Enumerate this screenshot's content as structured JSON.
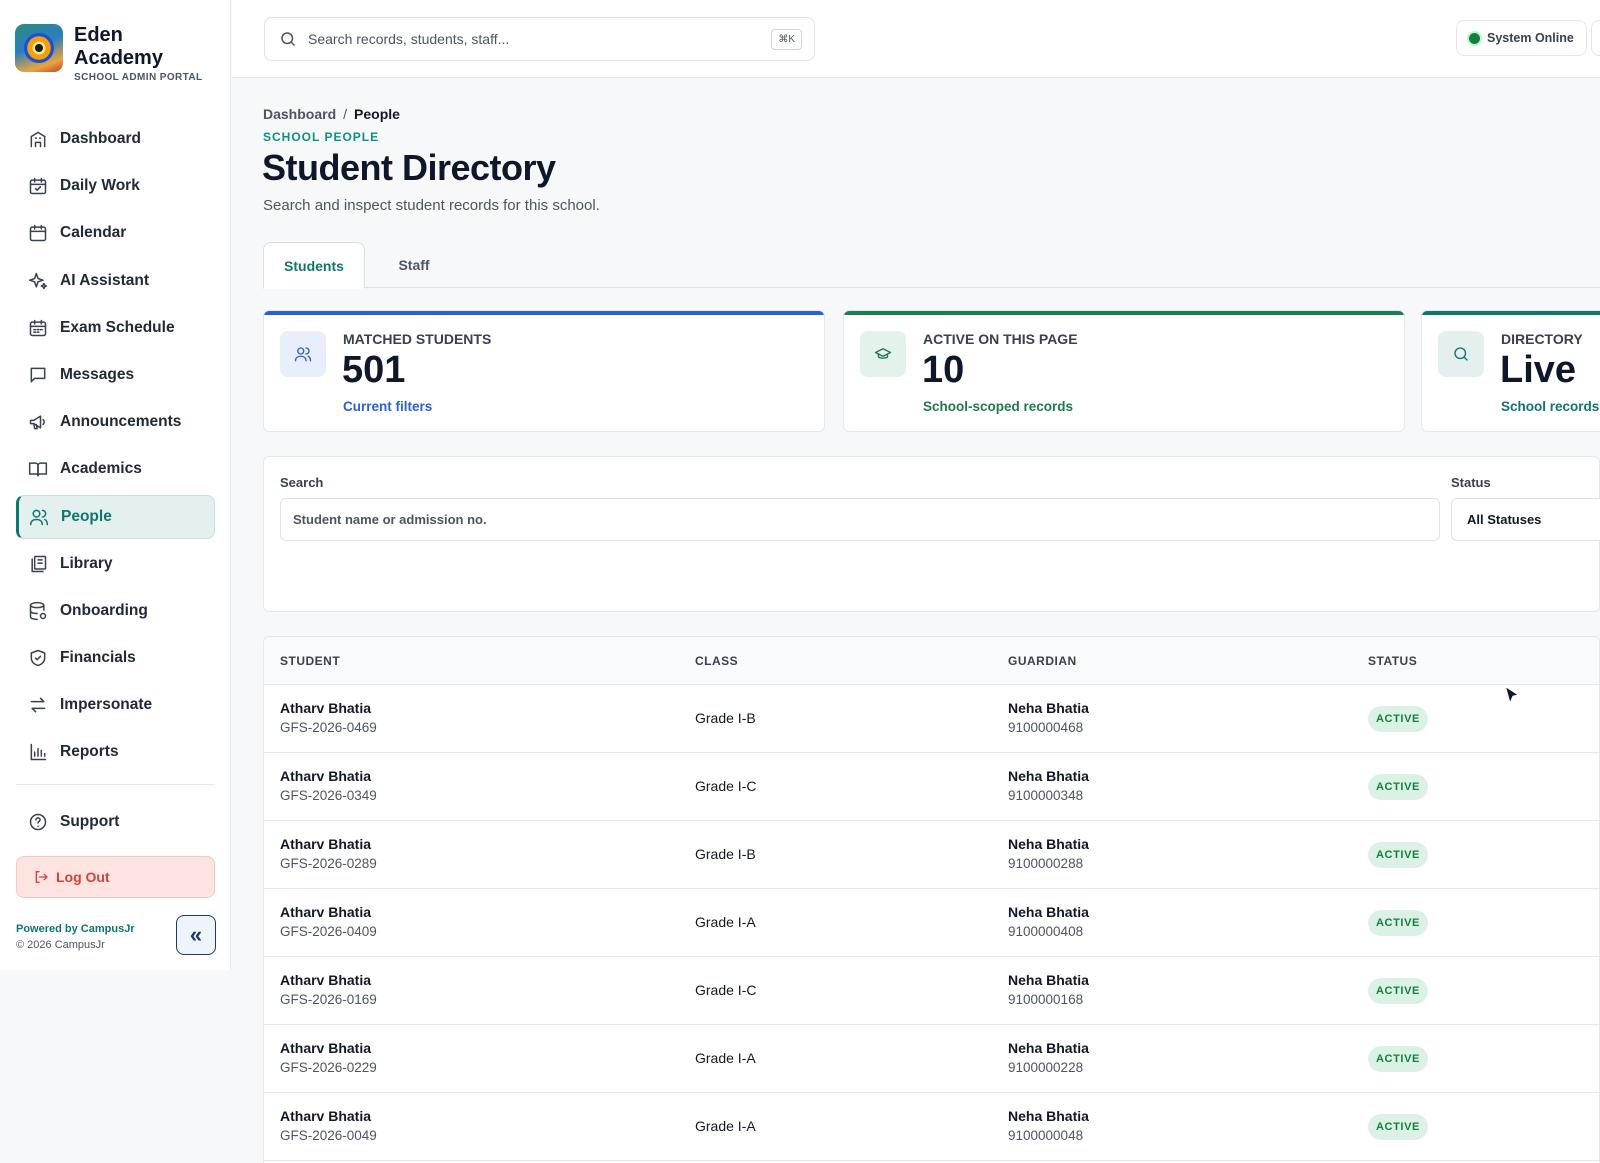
{
  "brand": {
    "name": "Eden Academy",
    "subtitle": "SCHOOL ADMIN PORTAL"
  },
  "sidebar": {
    "items": [
      {
        "label": "Dashboard",
        "icon": "building-icon"
      },
      {
        "label": "Daily Work",
        "icon": "calendar-check-icon"
      },
      {
        "label": "Calendar",
        "icon": "calendar-icon"
      },
      {
        "label": "AI Assistant",
        "icon": "sparkles-icon"
      },
      {
        "label": "Exam Schedule",
        "icon": "calendar-grid-icon"
      },
      {
        "label": "Messages",
        "icon": "message-icon"
      },
      {
        "label": "Announcements",
        "icon": "megaphone-icon"
      },
      {
        "label": "Academics",
        "icon": "book-icon"
      },
      {
        "label": "People",
        "icon": "users-icon",
        "active": true
      },
      {
        "label": "Library",
        "icon": "library-icon"
      },
      {
        "label": "Onboarding",
        "icon": "database-icon"
      },
      {
        "label": "Financials",
        "icon": "shield-icon"
      },
      {
        "label": "Impersonate",
        "icon": "swap-icon"
      },
      {
        "label": "Reports",
        "icon": "bar-chart-icon"
      }
    ],
    "support": "Support",
    "logout": "Log Out",
    "powered_by": "Powered by CampusJr",
    "copyright": "© 2026 CampusJr",
    "collapse_glyph": "«"
  },
  "topbar": {
    "search_placeholder": "Search records, students, staff...",
    "shortcut": "⌘K",
    "system_status": "System Online"
  },
  "breadcrumb": {
    "root": "Dashboard",
    "separator": "/",
    "current": "People"
  },
  "header": {
    "eyebrow": "SCHOOL PEOPLE",
    "title": "Student Directory",
    "subtitle": "Search and inspect student records for this school."
  },
  "tabs": {
    "students": "Students",
    "staff": "Staff"
  },
  "stats": [
    {
      "label": "MATCHED STUDENTS",
      "value": "501",
      "note": "Current filters",
      "accent": "#2b5fd6",
      "note_color": "#2b5fd6",
      "icon": "users-icon"
    },
    {
      "label": "ACTIVE ON THIS PAGE",
      "value": "10",
      "note": "School-scoped records",
      "accent": "#1f7a4d",
      "note_color": "#1f7a4d",
      "icon": "graduation-cap-icon"
    },
    {
      "label": "DIRECTORY",
      "value": "Live",
      "note": "School records",
      "accent": "#0f766e",
      "note_color": "#0f766e",
      "icon": "search-icon"
    }
  ],
  "filters": {
    "search_label": "Search",
    "search_placeholder": "Student name or admission no.",
    "status_label": "Status",
    "status_value": "All Statuses"
  },
  "table": {
    "columns": {
      "student": "STUDENT",
      "class": "CLASS",
      "guardian": "GUARDIAN",
      "status": "STATUS"
    },
    "rows": [
      {
        "name": "Atharv Bhatia",
        "id": "GFS-2026-0469",
        "class": "Grade I-B",
        "guardian": "Neha Bhatia",
        "phone": "9100000468",
        "status": "ACTIVE"
      },
      {
        "name": "Atharv Bhatia",
        "id": "GFS-2026-0349",
        "class": "Grade I-C",
        "guardian": "Neha Bhatia",
        "phone": "9100000348",
        "status": "ACTIVE"
      },
      {
        "name": "Atharv Bhatia",
        "id": "GFS-2026-0289",
        "class": "Grade I-B",
        "guardian": "Neha Bhatia",
        "phone": "9100000288",
        "status": "ACTIVE"
      },
      {
        "name": "Atharv Bhatia",
        "id": "GFS-2026-0409",
        "class": "Grade I-A",
        "guardian": "Neha Bhatia",
        "phone": "9100000408",
        "status": "ACTIVE"
      },
      {
        "name": "Atharv Bhatia",
        "id": "GFS-2026-0169",
        "class": "Grade I-C",
        "guardian": "Neha Bhatia",
        "phone": "9100000168",
        "status": "ACTIVE"
      },
      {
        "name": "Atharv Bhatia",
        "id": "GFS-2026-0229",
        "class": "Grade I-A",
        "guardian": "Neha Bhatia",
        "phone": "9100000228",
        "status": "ACTIVE"
      },
      {
        "name": "Atharv Bhatia",
        "id": "GFS-2026-0049",
        "class": "Grade I-A",
        "guardian": "Neha Bhatia",
        "phone": "9100000048",
        "status": "ACTIVE"
      }
    ]
  },
  "colors": {
    "primary": "#0f766e",
    "status_online": "#15803d",
    "danger": "#d0443a"
  }
}
